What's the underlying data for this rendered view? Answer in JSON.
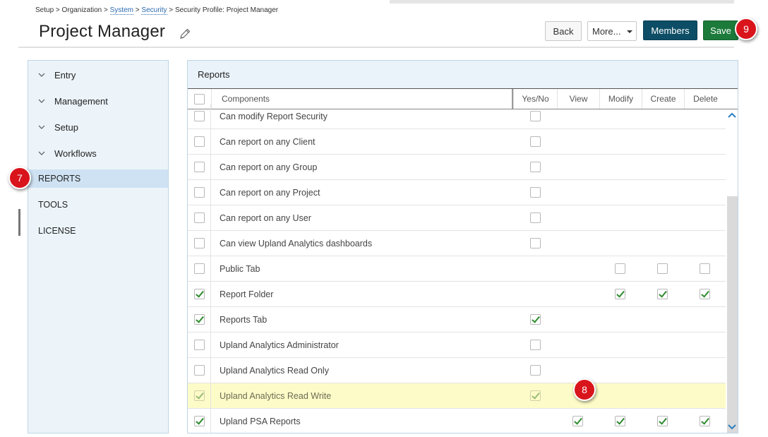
{
  "breadcrumb": {
    "setup": "Setup",
    "organization": "Organization",
    "system": "System",
    "security": "Security",
    "current": "Security Profile: Project Manager",
    "separator": " > "
  },
  "page_title": "Project Manager",
  "toolbar": {
    "back_label": "Back",
    "more_label": "More...",
    "members_label": "Members",
    "save_label": "Save"
  },
  "callouts": {
    "reports": "7",
    "row": "8",
    "save": "9"
  },
  "sidebar": {
    "items": [
      {
        "label": "Entry",
        "type": "group"
      },
      {
        "label": "Management",
        "type": "group"
      },
      {
        "label": "Setup",
        "type": "group"
      },
      {
        "label": "Workflows",
        "type": "group"
      },
      {
        "label": "REPORTS",
        "type": "item",
        "active": true
      },
      {
        "label": "TOOLS",
        "type": "item"
      },
      {
        "label": "LICENSE",
        "type": "item"
      }
    ]
  },
  "panel": {
    "title": "Reports",
    "columns": {
      "components": "Components",
      "yesno": "Yes/No",
      "view": "View",
      "modify": "Modify",
      "create": "Create",
      "delete": "Delete"
    },
    "rows": [
      {
        "label": "Can modify Report Security",
        "selected": false,
        "yesno": false
      },
      {
        "label": "Can report on any Client",
        "selected": false,
        "yesno": false
      },
      {
        "label": "Can report on any Group",
        "selected": false,
        "yesno": false
      },
      {
        "label": "Can report on any Project",
        "selected": false,
        "yesno": false
      },
      {
        "label": "Can report on any User",
        "selected": false,
        "yesno": false
      },
      {
        "label": "Can view Upland Analytics dashboards",
        "selected": false,
        "yesno": false
      },
      {
        "label": "Public Tab",
        "selected": false,
        "modify": false,
        "create": false,
        "delete": false
      },
      {
        "label": "Report Folder",
        "selected": true,
        "modify": true,
        "create": true,
        "delete": true
      },
      {
        "label": "Reports Tab",
        "selected": true,
        "yesno": true
      },
      {
        "label": "Upland Analytics Administrator",
        "selected": false,
        "yesno": false
      },
      {
        "label": "Upland Analytics Read Only",
        "selected": false,
        "yesno": false
      },
      {
        "label": "Upland Analytics Read Write",
        "selected": true,
        "yesno": true,
        "highlighted": true
      },
      {
        "label": "Upland PSA Reports",
        "selected": true,
        "view": true,
        "modify": true,
        "create": true,
        "delete": true
      }
    ]
  },
  "colors": {
    "members_bg": "#0d4d66",
    "save_bg": "#1c7a3a",
    "callout_bg": "#d9141b",
    "highlight_row": "#fdfcc8",
    "check": "#2e8b2e",
    "sidebar_bg": "#ecf4fa",
    "sidebar_active": "#cfe2f3"
  }
}
